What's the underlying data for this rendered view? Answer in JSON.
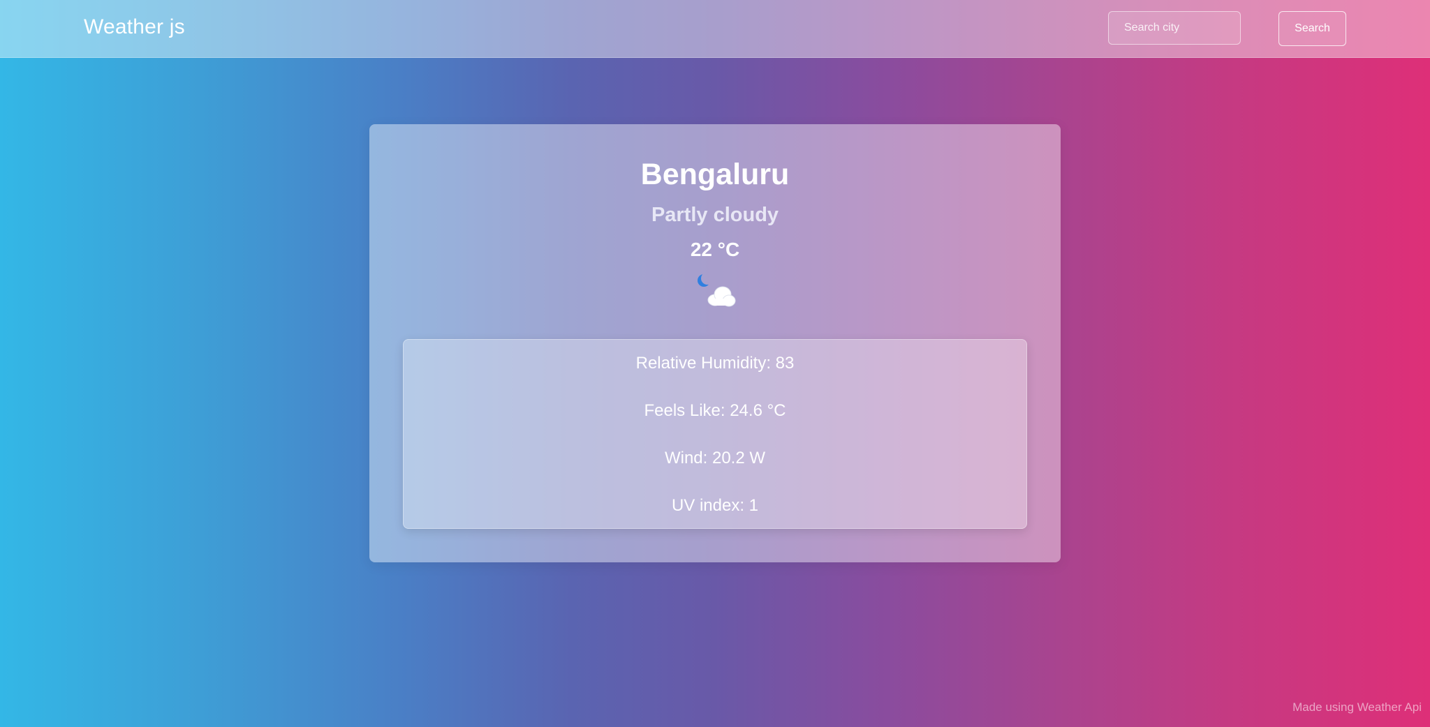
{
  "header": {
    "brand": "Weather js",
    "search_placeholder": "Search city",
    "search_label": "Search"
  },
  "weather": {
    "city": "Bengaluru",
    "condition": "Partly cloudy",
    "temperature": "22 °C",
    "icon": "partly-cloudy-night-icon"
  },
  "details": {
    "humidity": "Relative Humidity: 83",
    "feels_like": "Feels Like: 24.6 °C",
    "wind": "Wind: 20.2 W",
    "uv": "UV index: 1"
  },
  "footer": {
    "text": "Made using Weather Api"
  },
  "colors": {
    "gradient_start": "#33b7e6",
    "gradient_mid": "#6959a8",
    "gradient_end": "#de2f78"
  }
}
